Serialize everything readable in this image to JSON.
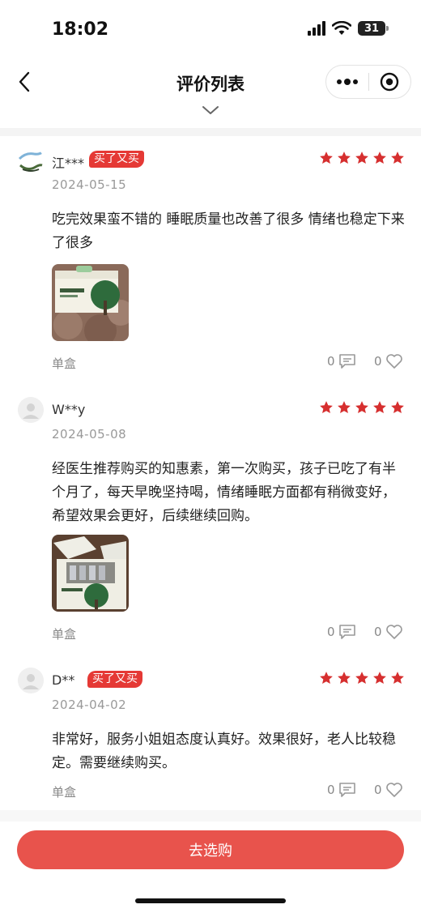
{
  "status_bar": {
    "time": "18:02",
    "battery": "31"
  },
  "nav": {
    "title": "评价列表"
  },
  "reviews": [
    {
      "user": "江***",
      "badge": "买了又买",
      "rating": 5,
      "date": "2024-05-15",
      "text": "吃完效果蛮不错的 睡眠质量也改善了很多 情绪也稳定下来了很多",
      "spec": "单盒",
      "comments": "0",
      "likes": "0"
    },
    {
      "user": "W**y",
      "badge": "",
      "rating": 5,
      "date": "2024-05-08",
      "text": "经医生推荐购买的知惠素，第一次购买，孩子已吃了有半个月了，每天早晚坚持喝，情绪睡眠方面都有稍微变好，希望效果会更好，后续继续回购。",
      "spec": "单盒",
      "comments": "0",
      "likes": "0"
    },
    {
      "user": "D**",
      "badge": "买了又买",
      "rating": 5,
      "date": "2024-04-02",
      "text": "非常好，服务小姐姐态度认真好。效果很好，老人比较稳定。需要继续购买。",
      "spec": "单盒",
      "comments": "0",
      "likes": "0"
    }
  ],
  "footer": {
    "buy_label": "去选购"
  },
  "colors": {
    "accent": "#e53935",
    "button": "#e8534c",
    "muted": "#999999"
  }
}
